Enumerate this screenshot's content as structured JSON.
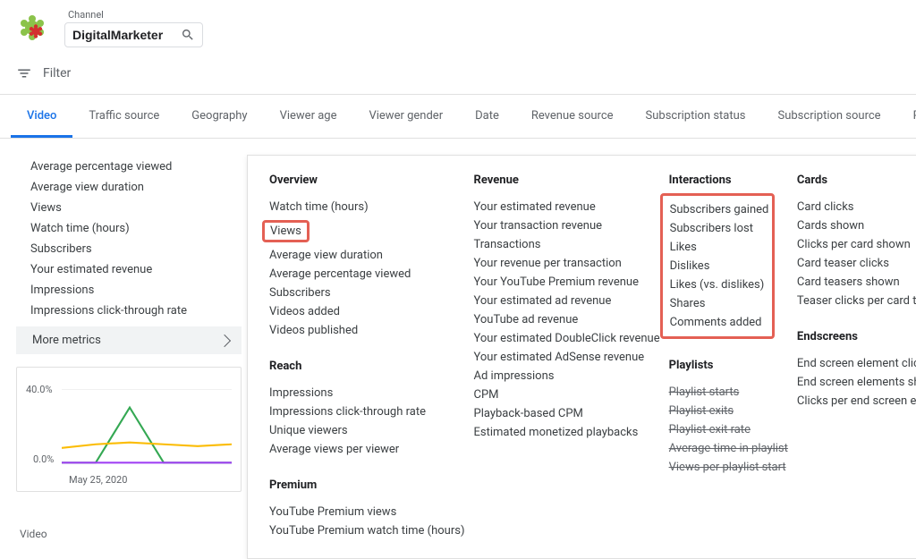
{
  "header": {
    "channel_label": "Channel",
    "channel_value": "DigitalMarketer"
  },
  "filter": {
    "label": "Filter"
  },
  "tabs": [
    "Video",
    "Traffic source",
    "Geography",
    "Viewer age",
    "Viewer gender",
    "Date",
    "Revenue source",
    "Subscription status",
    "Subscription source",
    "Playlist"
  ],
  "active_tab_index": 0,
  "left_metrics": [
    "Average percentage viewed",
    "Average view duration",
    "Views",
    "Watch time (hours)",
    "Subscribers",
    "Your estimated revenue",
    "Impressions",
    "Impressions click-through rate"
  ],
  "more_metrics_label": "More metrics",
  "chart_data": {
    "type": "line",
    "y_ticks": [
      "40.0%",
      "0.0%"
    ],
    "x_tick": "May 25, 2020",
    "series": [
      {
        "name": "green",
        "color": "#34a853",
        "points": [
          0,
          0,
          30,
          0,
          0,
          0
        ]
      },
      {
        "name": "orange",
        "color": "#fbbc04",
        "points": [
          8,
          10,
          11,
          10,
          9,
          10
        ]
      },
      {
        "name": "purple",
        "color": "#a142f4",
        "points": [
          0,
          0,
          0,
          0,
          0,
          0
        ]
      }
    ],
    "ylim": [
      0,
      40
    ]
  },
  "below_chart_label": "Video",
  "panel": {
    "col1": {
      "overview": {
        "heading": "Overview",
        "items": [
          "Watch time (hours)",
          "Views",
          "Average view duration",
          "Average percentage viewed",
          "Subscribers",
          "Videos added",
          "Videos published"
        ],
        "highlight_index": 1
      },
      "reach": {
        "heading": "Reach",
        "items": [
          "Impressions",
          "Impressions click-through rate",
          "Unique viewers",
          "Average views per viewer"
        ]
      },
      "premium": {
        "heading": "Premium",
        "items": [
          "YouTube Premium views",
          "YouTube Premium watch time (hours)"
        ]
      }
    },
    "col2": {
      "revenue": {
        "heading": "Revenue",
        "items": [
          "Your estimated revenue",
          "Your transaction revenue",
          "Transactions",
          "Your revenue per transaction",
          "Your YouTube Premium revenue",
          "Your estimated ad revenue",
          "YouTube ad revenue",
          "Your estimated DoubleClick revenue",
          "Your estimated AdSense revenue",
          "Ad impressions",
          "CPM",
          "Playback-based CPM",
          "Estimated monetized playbacks"
        ]
      }
    },
    "col3": {
      "interactions": {
        "heading": "Interactions",
        "items": [
          "Subscribers gained",
          "Subscribers lost",
          "Likes",
          "Dislikes",
          "Likes (vs. dislikes)",
          "Shares",
          "Comments added"
        ]
      },
      "playlists": {
        "heading": "Playlists",
        "items": [
          "Playlist starts",
          "Playlist exits",
          "Playlist exit rate",
          "Average time in playlist",
          "Views per playlist start"
        ]
      }
    },
    "col4": {
      "cards": {
        "heading": "Cards",
        "items": [
          "Card clicks",
          "Cards shown",
          "Clicks per card shown",
          "Card teaser clicks",
          "Card teasers shown",
          "Teaser clicks per card teaser shown"
        ]
      },
      "endscreens": {
        "heading": "Endscreens",
        "items": [
          "End screen element clicks",
          "End screen elements shown",
          "Clicks per end screen element shown"
        ]
      }
    }
  }
}
